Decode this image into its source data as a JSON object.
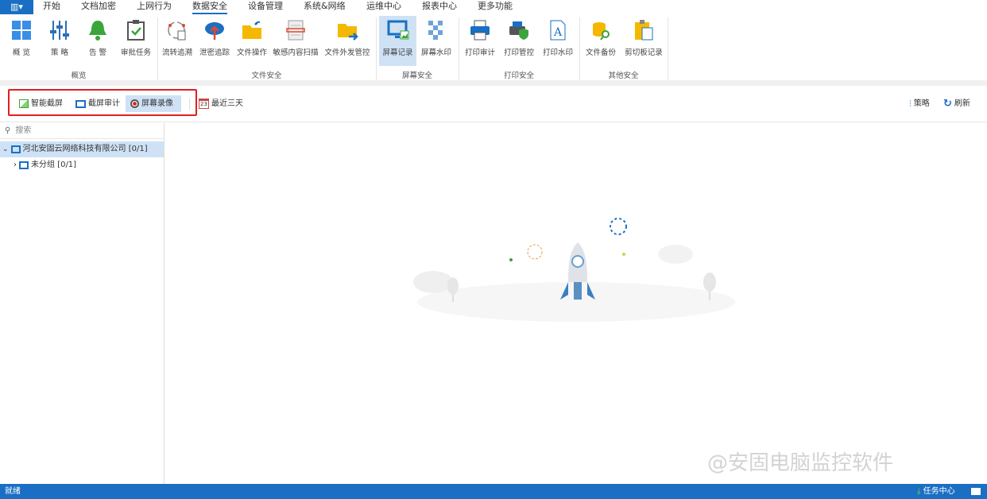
{
  "menubar": {
    "app_icon": "app-menu-icon",
    "items": [
      "开始",
      "文档加密",
      "上网行为",
      "数据安全",
      "设备管理",
      "系统&网络",
      "运维中心",
      "报表中心",
      "更多功能"
    ],
    "active": "数据安全"
  },
  "ribbon": {
    "groups": [
      "概览",
      "文件安全",
      "屏幕安全",
      "打印安全",
      "其他安全"
    ],
    "buttons": [
      "概 览",
      "策 略",
      "告 警",
      "审批任务",
      "流转追溯",
      "泄密追踪",
      "文件操作",
      "敏感内容扫描",
      "文件外发管控",
      "屏幕记录",
      "屏幕水印",
      "打印审计",
      "打印管控",
      "打印水印",
      "文件备份",
      "剪切板记录"
    ],
    "selected": "屏幕记录"
  },
  "toolbar": {
    "tabs": [
      "智能截屏",
      "截屏审计",
      "屏幕录像"
    ],
    "selected_tab": "屏幕录像",
    "date_filter": "最近三天",
    "policy": "策略",
    "refresh": "刷新"
  },
  "tree": {
    "search_placeholder": "搜索",
    "root": "河北安固云网络科技有限公司 [0/1]",
    "child": "未分组 [0/1]"
  },
  "status": {
    "left": "就绪",
    "task_center": "任务中心"
  },
  "watermark": "@安固电脑监控软件",
  "colors": {
    "accent": "#1a6fc4",
    "selected": "#cfe2f5",
    "highlight_box": "#e02020"
  }
}
